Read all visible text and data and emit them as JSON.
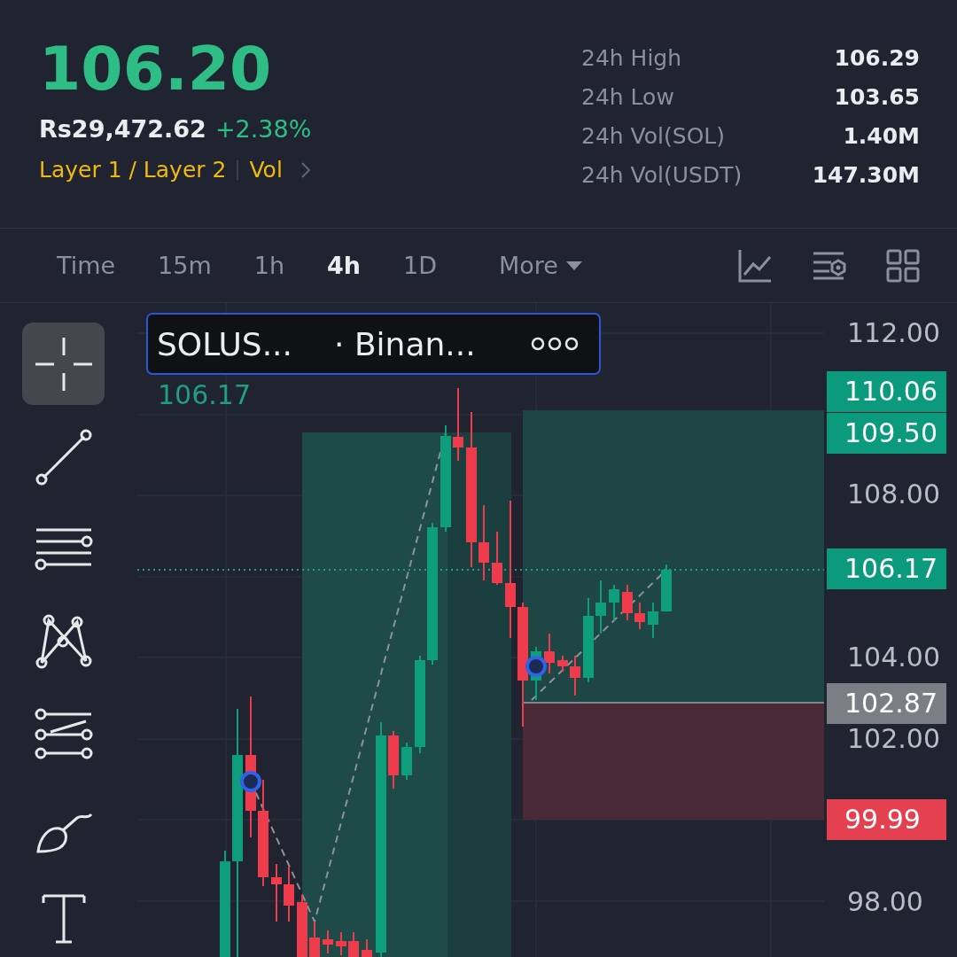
{
  "price": {
    "last": "106.20",
    "fiat": "Rs29,472.62",
    "change": "+2.38%"
  },
  "tags": [
    "Layer 1 / Layer 2",
    "Vol"
  ],
  "stats": [
    {
      "label": "24h High",
      "value": "106.29"
    },
    {
      "label": "24h Low",
      "value": "103.65"
    },
    {
      "label": "24h Vol(SOL)",
      "value": "1.40M"
    },
    {
      "label": "24h Vol(USDT)",
      "value": "147.30M"
    }
  ],
  "intervals": [
    {
      "label": "Time",
      "selected": false
    },
    {
      "label": "15m",
      "selected": false
    },
    {
      "label": "1h",
      "selected": false
    },
    {
      "label": "4h",
      "selected": true
    },
    {
      "label": "1D",
      "selected": false
    }
  ],
  "more_menu": "More",
  "tools": [
    {
      "kind": "crosshair",
      "selected": true
    },
    {
      "kind": "trendline",
      "selected": false
    },
    {
      "kind": "hlines",
      "selected": false
    },
    {
      "kind": "pattern",
      "selected": false
    },
    {
      "kind": "channel",
      "selected": false
    },
    {
      "kind": "brush",
      "selected": false
    },
    {
      "kind": "text",
      "selected": false
    }
  ],
  "chart": {
    "legend": {
      "symbol": "SOLUS...",
      "exchange": "· Binan..."
    },
    "last_label": "106.17",
    "axis_labels": [
      "112.00",
      "108.00",
      "104.00",
      "102.00",
      "98.00"
    ],
    "price_tags": [
      {
        "value": "110.06",
        "kind": "target"
      },
      {
        "value": "109.50",
        "kind": "target"
      },
      {
        "value": "106.17",
        "kind": "last"
      },
      {
        "value": "102.87",
        "kind": "entry"
      },
      {
        "value": "99.99",
        "kind": "stop"
      }
    ]
  }
}
